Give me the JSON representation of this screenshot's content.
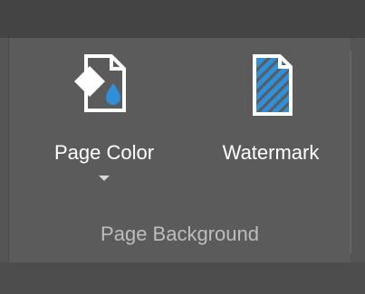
{
  "ribbon": {
    "group": {
      "label": "Page Background",
      "commands": [
        {
          "label": "Page Color",
          "icon": "page-color-icon",
          "has_dropdown": true
        },
        {
          "label": "Watermark",
          "icon": "watermark-icon",
          "has_dropdown": false
        }
      ]
    }
  },
  "colors": {
    "background": "#555555",
    "text": "#ffffff",
    "group_label_text": "#bdbdbd",
    "accent_blue": "#2f8fd8"
  }
}
